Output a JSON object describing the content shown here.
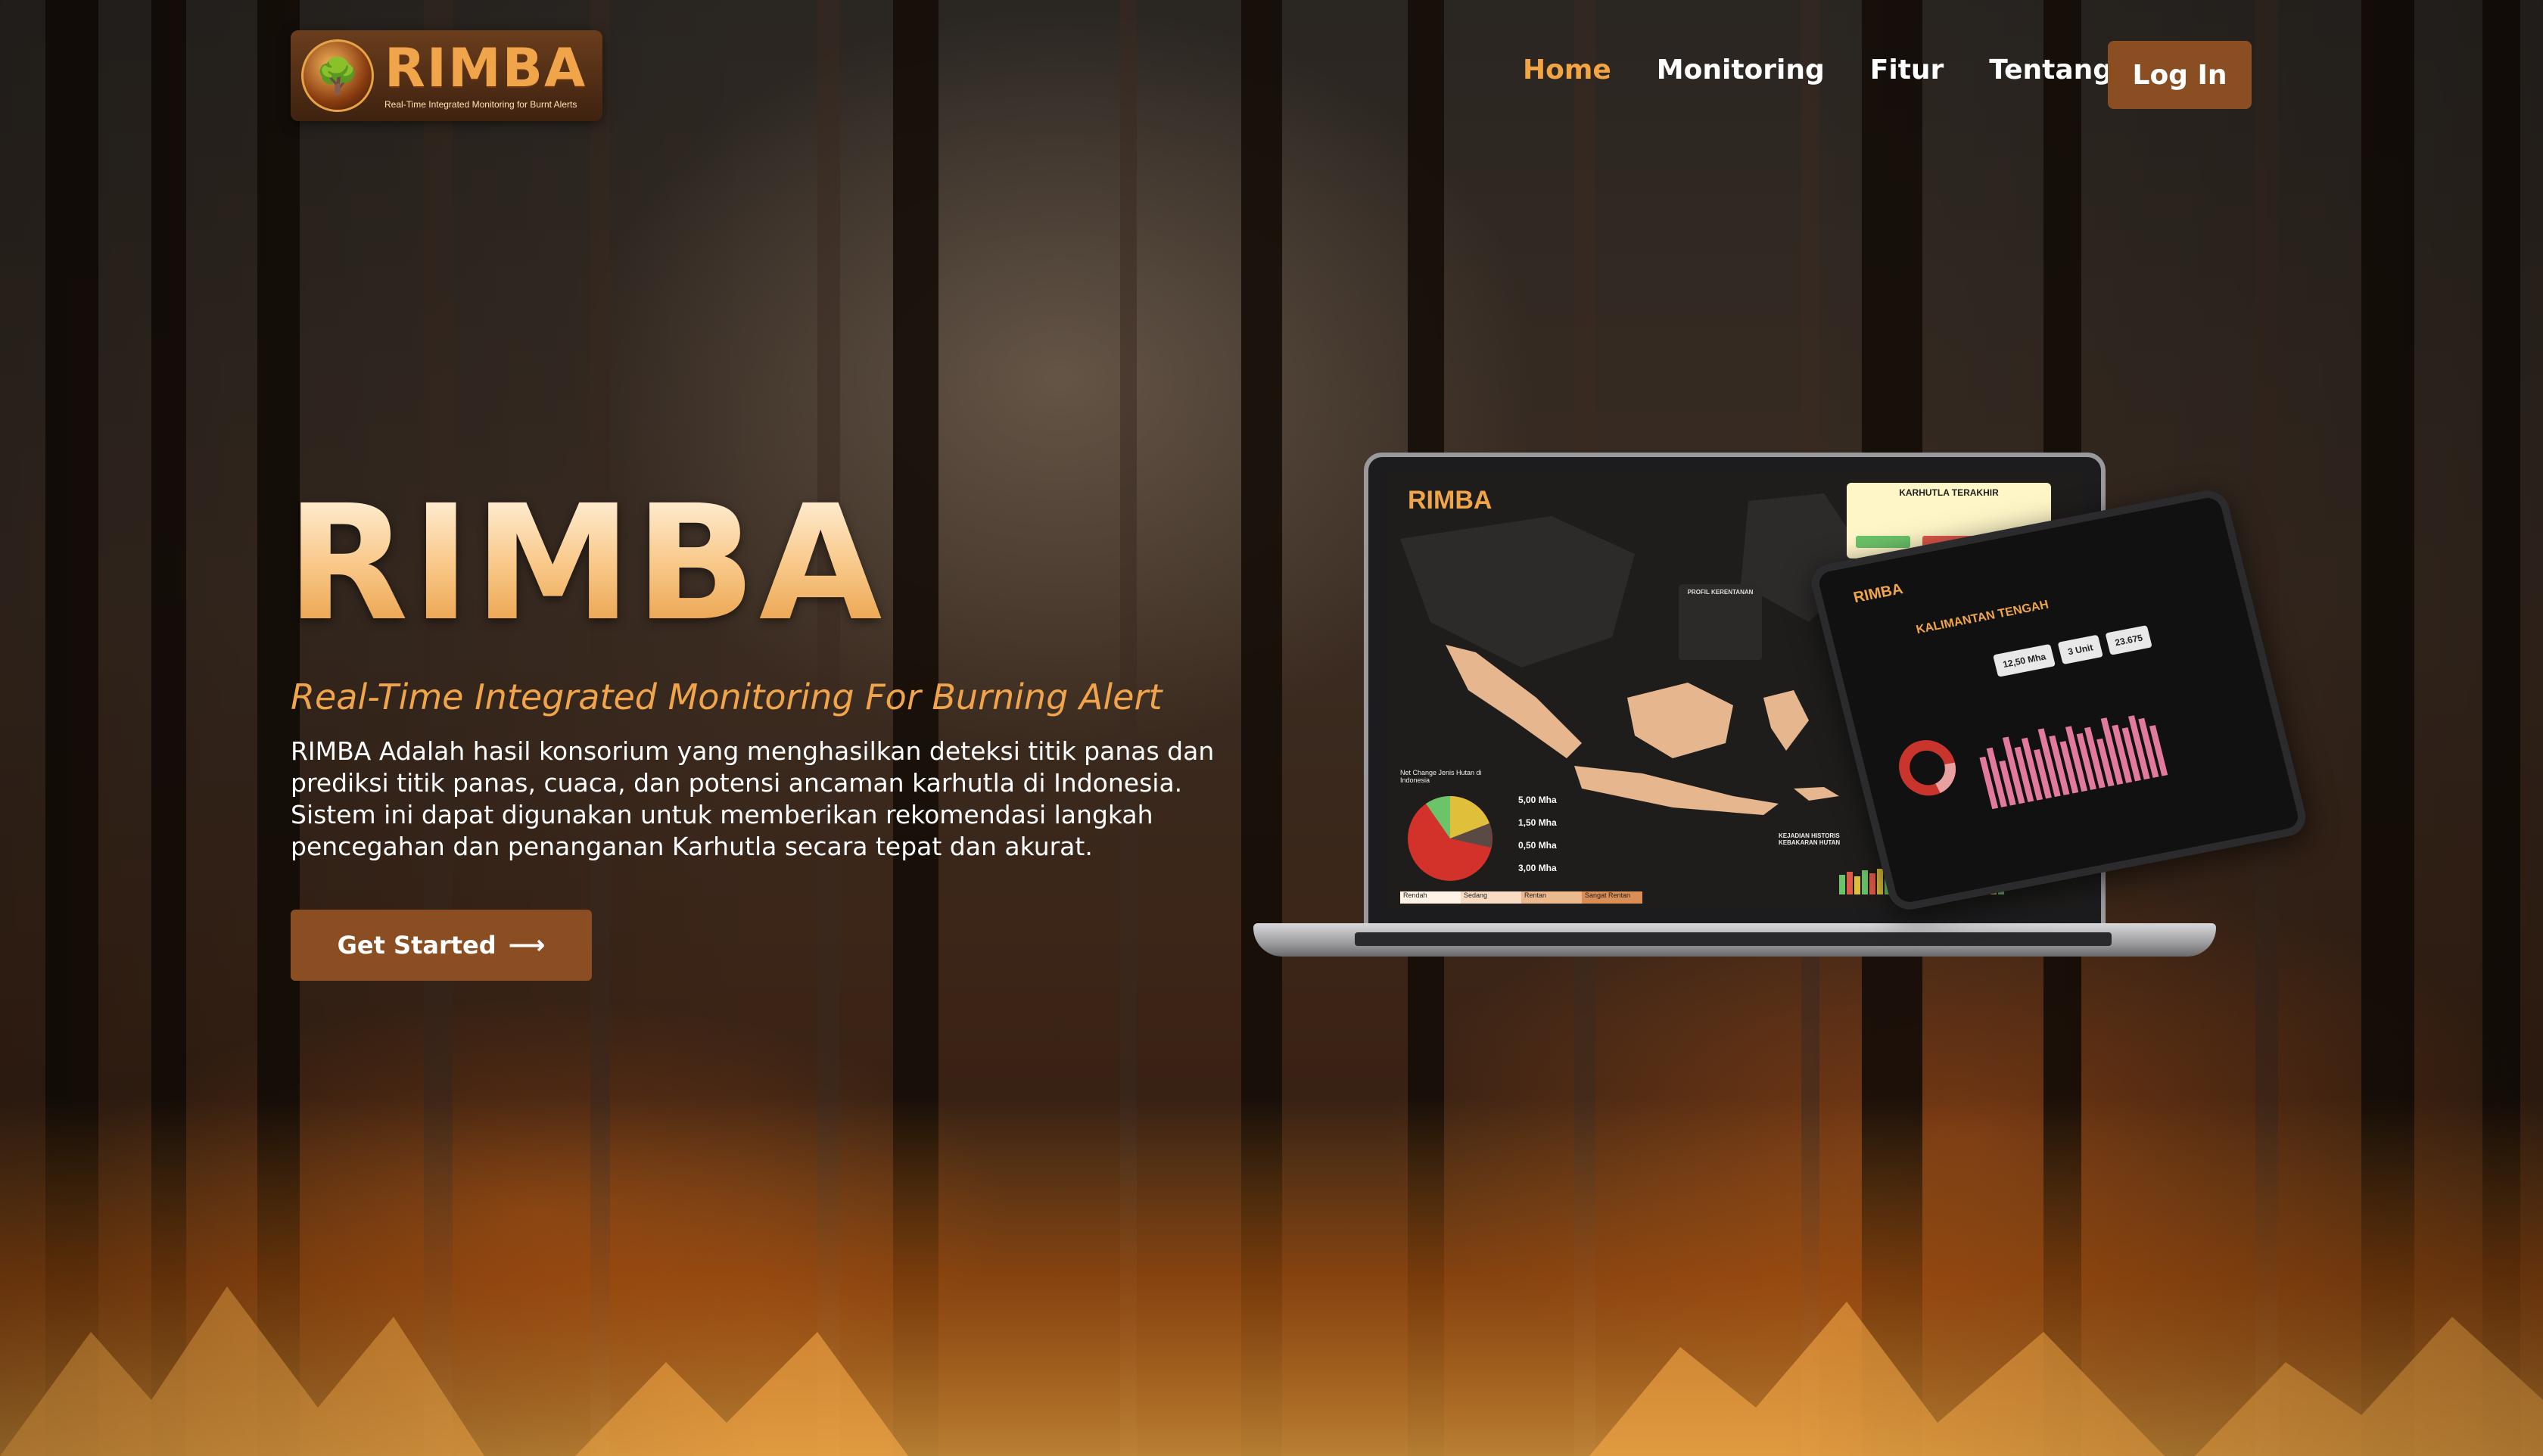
{
  "brand": {
    "logo_word": "RIMBA",
    "logo_tagline": "Real-Time Integrated Monitoring for Burnt Alerts"
  },
  "nav": {
    "items": [
      {
        "label": "Home",
        "active": true
      },
      {
        "label": "Monitoring",
        "active": false
      },
      {
        "label": "Fitur",
        "active": false
      },
      {
        "label": "Tentang",
        "active": false
      }
    ],
    "login_label": "Log In"
  },
  "hero": {
    "title": "RIMBA",
    "subtitle": "Real-Time Integrated Monitoring For Burning Alert",
    "description": "RIMBA Adalah hasil konsorium yang menghasilkan deteksi titik panas dan prediksi titik panas, cuaca, dan potensi ancaman karhutla di Indonesia. Sistem ini dapat digunakan untuk memberikan rekomendasi langkah pencegahan dan penanganan Karhutla secara tepat dan akurat.",
    "cta_label": "Get Started",
    "cta_icon": "arrow-right-icon"
  },
  "dashboard_preview": {
    "logo_word": "RIMBA",
    "alert_title": "KARHUTLA TERAKHIR",
    "profile_title": "PROFIL KERENTANAN",
    "netchange_title": "Net Change Jenis Hutan di Indonesia",
    "stats": [
      "5,00 Mha",
      "1,50 Mha",
      "0,50 Mha",
      "3,00 Mha"
    ],
    "history_title": "KEJADIAN HISTORIS KEBAKARAN HUTAN",
    "legend": [
      "Rendah",
      "Sedang",
      "Rentan",
      "Sangat Rentan"
    ],
    "tablet_region": "KALIMANTAN TENGAH",
    "tablet_stats": [
      "12,50 Mha",
      "3 Unit",
      "23.675"
    ]
  },
  "colors": {
    "accent": "#f3a545",
    "button": "#8a4e22",
    "text": "#ffffff"
  }
}
